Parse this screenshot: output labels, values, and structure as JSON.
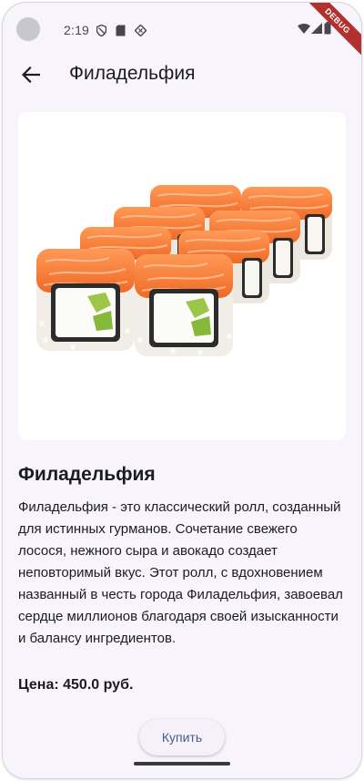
{
  "status_bar": {
    "time": "2:19",
    "icons": [
      "shield-icon",
      "sim-card-icon",
      "location-off-icon",
      "wifi-icon",
      "signal-icon",
      "battery-icon"
    ]
  },
  "debug_banner": "DEBUG",
  "app_bar": {
    "title": "Филадельфия",
    "back_icon": "arrow-back-icon"
  },
  "product": {
    "name": "Филадельфия",
    "description": "Филадельфия - это классический ролл, созданный для истинных гурманов. Сочетание свежего лосося, нежного сыра и авокадо создает неповторимый вкус. Этот ролл, с вдохновением названный в честь города Филадельфия, завоевал сердце миллионов благодаря своей изысканности и балансу ингредиентов.",
    "price": "Цена: 450.0 руб."
  },
  "actions": {
    "buy_label": "Купить"
  },
  "colors": {
    "background": "#f7f5fb",
    "salmon": "#f47a3a",
    "buy_text": "#4a5b8c",
    "debug_ribbon": "#b2302e"
  }
}
